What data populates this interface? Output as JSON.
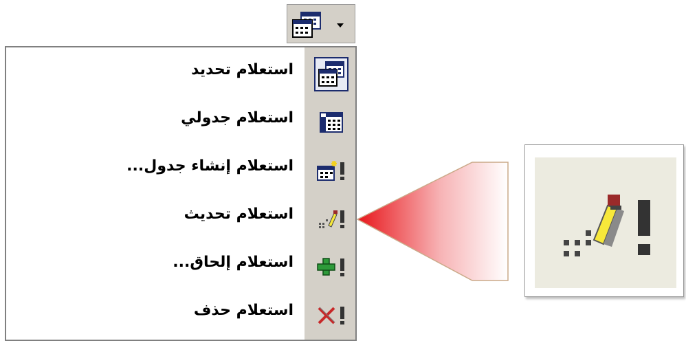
{
  "toolbar": {
    "button_icon": "query-type-icon",
    "dropdown_icon": "dropdown-arrow-icon"
  },
  "menu": {
    "items": [
      {
        "label": "استعلام تحديد",
        "icon": "select-query-icon",
        "selected": true
      },
      {
        "label": "استعلام جدولي",
        "icon": "crosstab-query-icon",
        "selected": false
      },
      {
        "label": "استعلام إنشاء جدول...",
        "icon": "make-table-query-icon",
        "selected": false
      },
      {
        "label": "استعلام تحديث",
        "icon": "update-query-icon",
        "selected": false
      },
      {
        "label": "استعلام إلحاق...",
        "icon": "append-query-icon",
        "selected": false
      },
      {
        "label": "استعلام حذف",
        "icon": "delete-query-icon",
        "selected": false
      }
    ]
  },
  "callout": {
    "icon": "update-query-icon",
    "color": "#e8161b"
  },
  "colors": {
    "menu_gutter": "#d4d0c8",
    "selected_border": "#1c2c6e",
    "zoom_background": "#ecebe0"
  }
}
